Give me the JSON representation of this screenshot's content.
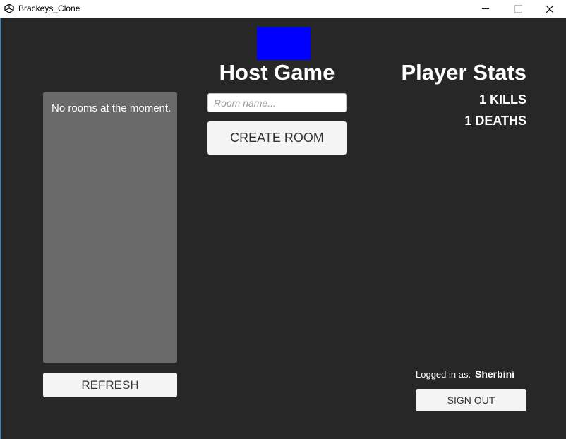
{
  "window": {
    "title": "Brackeys_Clone",
    "app_icon": "unity-icon",
    "controls": {
      "minimize": "—",
      "maximize": "☐",
      "close": "✕"
    }
  },
  "rooms": {
    "empty_message": "No rooms at the moment.",
    "refresh_label": "REFRESH"
  },
  "host": {
    "title": "Host Game",
    "room_name_placeholder": "Room name...",
    "room_name_value": "",
    "create_label": "CREATE ROOM"
  },
  "stats": {
    "title": "Player Stats",
    "kills": "1 KILLS",
    "deaths": "1 DEATHS"
  },
  "account": {
    "logged_in_label": "Logged in as:",
    "username": "Sherbini",
    "sign_out_label": "SIGN OUT"
  },
  "colors": {
    "background": "#272727",
    "room_list_bg": "#6a6a6a",
    "banner": "#0000ff",
    "button_bg": "#f4f4f4",
    "window_border": "#2b88d8"
  }
}
